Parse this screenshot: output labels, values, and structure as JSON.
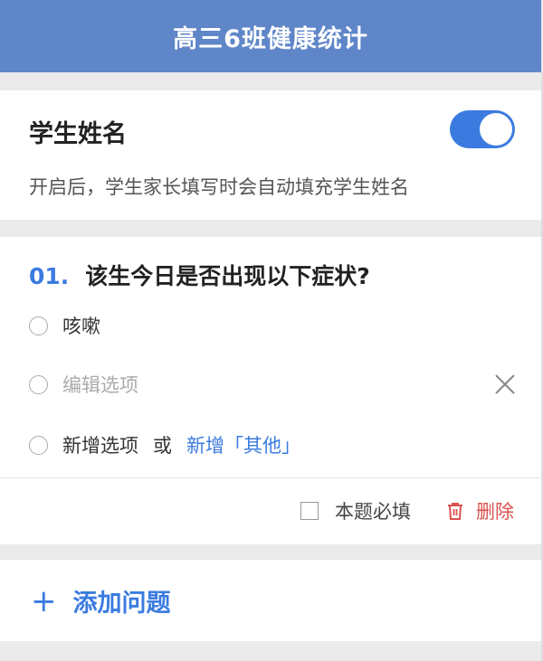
{
  "header": {
    "title": "高三6班健康统计"
  },
  "student_name": {
    "title": "学生姓名",
    "toggle_on": true,
    "description": "开启后，学生家长填写时会自动填充学生姓名"
  },
  "question": {
    "number": "01.",
    "title": "该生今日是否出现以下症状?",
    "options": [
      {
        "label": "咳嗽"
      },
      {
        "placeholder": "编辑选项"
      }
    ],
    "add_option": {
      "label": "新增选项",
      "or": "或",
      "add_other": "新增「其他」"
    },
    "required_label": "本题必填",
    "delete_label": "删除"
  },
  "add_question": {
    "label": "添加问题"
  },
  "colors": {
    "accent": "#3b7be0",
    "header_bg": "#5f86c9",
    "delete": "#d9534f"
  }
}
